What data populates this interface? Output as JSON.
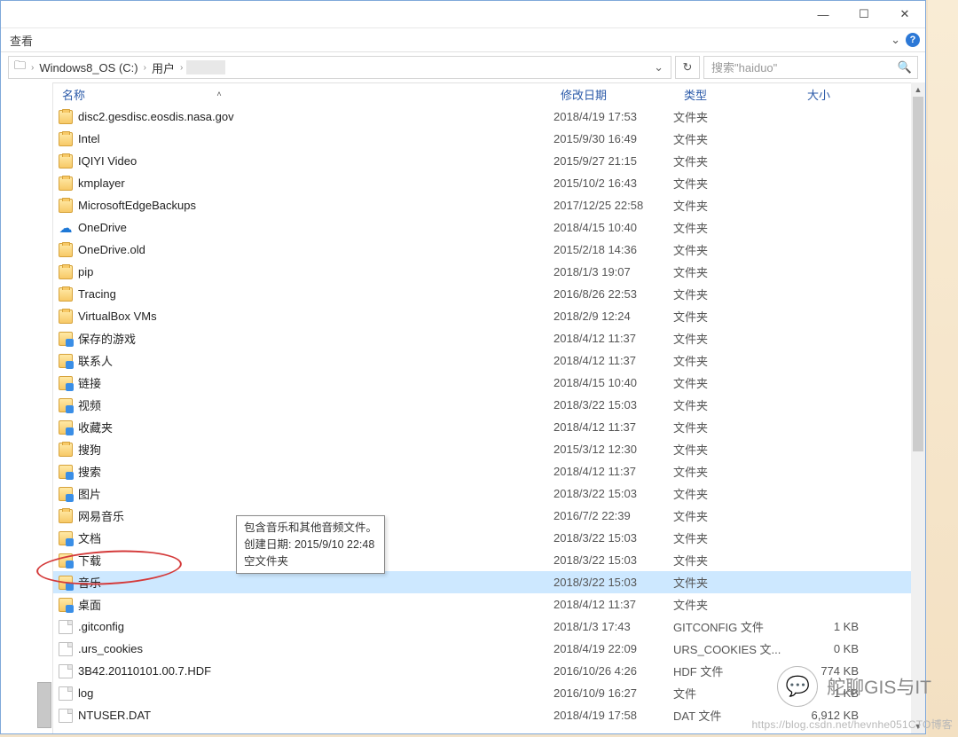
{
  "window_controls": {
    "min": "—",
    "max": "☐",
    "close": "✕"
  },
  "ribbon": {
    "view_tab": "查看",
    "chevron": "⌄",
    "help": "?"
  },
  "breadcrumb": {
    "sep_icon": "›",
    "parts": [
      "",
      "Windows8_OS (C:)",
      "用户",
      ""
    ]
  },
  "search": {
    "placeholder": "搜索\"haiduo\"",
    "icon": "🔍"
  },
  "refresh_icon": "↻",
  "columns": {
    "name": "名称",
    "date": "修改日期",
    "type": "类型",
    "size": "大小",
    "sort_indicator": "˄"
  },
  "tooltip": {
    "line1": "包含音乐和其他音频文件。",
    "line2": "创建日期: 2015/9/10 22:48",
    "line3": "空文件夹"
  },
  "watermark": {
    "icon": "💬",
    "text": "舵聊GIS与IT",
    "url": "https://blog.csdn.net/hevnhe051CTO博客"
  },
  "rows": [
    {
      "icon": "folder",
      "name": "disc2.gesdisc.eosdis.nasa.gov",
      "date": "2018/4/19 17:53",
      "type": "文件夹",
      "size": ""
    },
    {
      "icon": "folder",
      "name": "Intel",
      "date": "2015/9/30 16:49",
      "type": "文件夹",
      "size": ""
    },
    {
      "icon": "folder",
      "name": "IQIYI Video",
      "date": "2015/9/27 21:15",
      "type": "文件夹",
      "size": ""
    },
    {
      "icon": "folder",
      "name": "kmplayer",
      "date": "2015/10/2 16:43",
      "type": "文件夹",
      "size": ""
    },
    {
      "icon": "folder",
      "name": "MicrosoftEdgeBackups",
      "date": "2017/12/25 22:58",
      "type": "文件夹",
      "size": ""
    },
    {
      "icon": "onedrive",
      "name": "OneDrive",
      "date": "2018/4/15 10:40",
      "type": "文件夹",
      "size": ""
    },
    {
      "icon": "folder",
      "name": "OneDrive.old",
      "date": "2015/2/18 14:36",
      "type": "文件夹",
      "size": ""
    },
    {
      "icon": "folder",
      "name": "pip",
      "date": "2018/1/3 19:07",
      "type": "文件夹",
      "size": ""
    },
    {
      "icon": "folder",
      "name": "Tracing",
      "date": "2016/8/26 22:53",
      "type": "文件夹",
      "size": ""
    },
    {
      "icon": "folder",
      "name": "VirtualBox VMs",
      "date": "2018/2/9 12:24",
      "type": "文件夹",
      "size": ""
    },
    {
      "icon": "folder-sp",
      "name": "保存的游戏",
      "date": "2018/4/12 11:37",
      "type": "文件夹",
      "size": ""
    },
    {
      "icon": "folder-sp",
      "name": "联系人",
      "date": "2018/4/12 11:37",
      "type": "文件夹",
      "size": ""
    },
    {
      "icon": "folder-sp",
      "name": "链接",
      "date": "2018/4/15 10:40",
      "type": "文件夹",
      "size": ""
    },
    {
      "icon": "folder-sp",
      "name": "视频",
      "date": "2018/3/22 15:03",
      "type": "文件夹",
      "size": ""
    },
    {
      "icon": "folder-sp",
      "name": "收藏夹",
      "date": "2018/4/12 11:37",
      "type": "文件夹",
      "size": ""
    },
    {
      "icon": "folder",
      "name": "搜狗",
      "date": "2015/3/12 12:30",
      "type": "文件夹",
      "size": ""
    },
    {
      "icon": "folder-sp",
      "name": "搜索",
      "date": "2018/4/12 11:37",
      "type": "文件夹",
      "size": ""
    },
    {
      "icon": "folder-sp",
      "name": "图片",
      "date": "2018/3/22 15:03",
      "type": "文件夹",
      "size": ""
    },
    {
      "icon": "folder",
      "name": "网易音乐",
      "date": "2016/7/2 22:39",
      "type": "文件夹",
      "size": ""
    },
    {
      "icon": "folder-sp",
      "name": "文档",
      "date": "2018/3/22 15:03",
      "type": "文件夹",
      "size": ""
    },
    {
      "icon": "folder-sp",
      "name": "下载",
      "date": "2018/3/22 15:03",
      "type": "文件夹",
      "size": ""
    },
    {
      "icon": "folder-sp",
      "name": "音乐",
      "date": "2018/3/22 15:03",
      "type": "文件夹",
      "size": "",
      "selected": true
    },
    {
      "icon": "folder-sp",
      "name": "桌面",
      "date": "2018/4/12 11:37",
      "type": "文件夹",
      "size": ""
    },
    {
      "icon": "file",
      "name": ".gitconfig",
      "date": "2018/1/3 17:43",
      "type": "GITCONFIG 文件",
      "size": "1 KB"
    },
    {
      "icon": "file",
      "name": ".urs_cookies",
      "date": "2018/4/19 22:09",
      "type": "URS_COOKIES 文...",
      "size": "0 KB"
    },
    {
      "icon": "file",
      "name": "3B42.20110101.00.7.HDF",
      "date": "2016/10/26 4:26",
      "type": "HDF 文件",
      "size": "774 KB"
    },
    {
      "icon": "file",
      "name": "log",
      "date": "2016/10/9 16:27",
      "type": "文件",
      "size": "1 KB"
    },
    {
      "icon": "file",
      "name": "NTUSER.DAT",
      "date": "2018/4/19 17:58",
      "type": "DAT 文件",
      "size": "6,912 KB"
    }
  ]
}
